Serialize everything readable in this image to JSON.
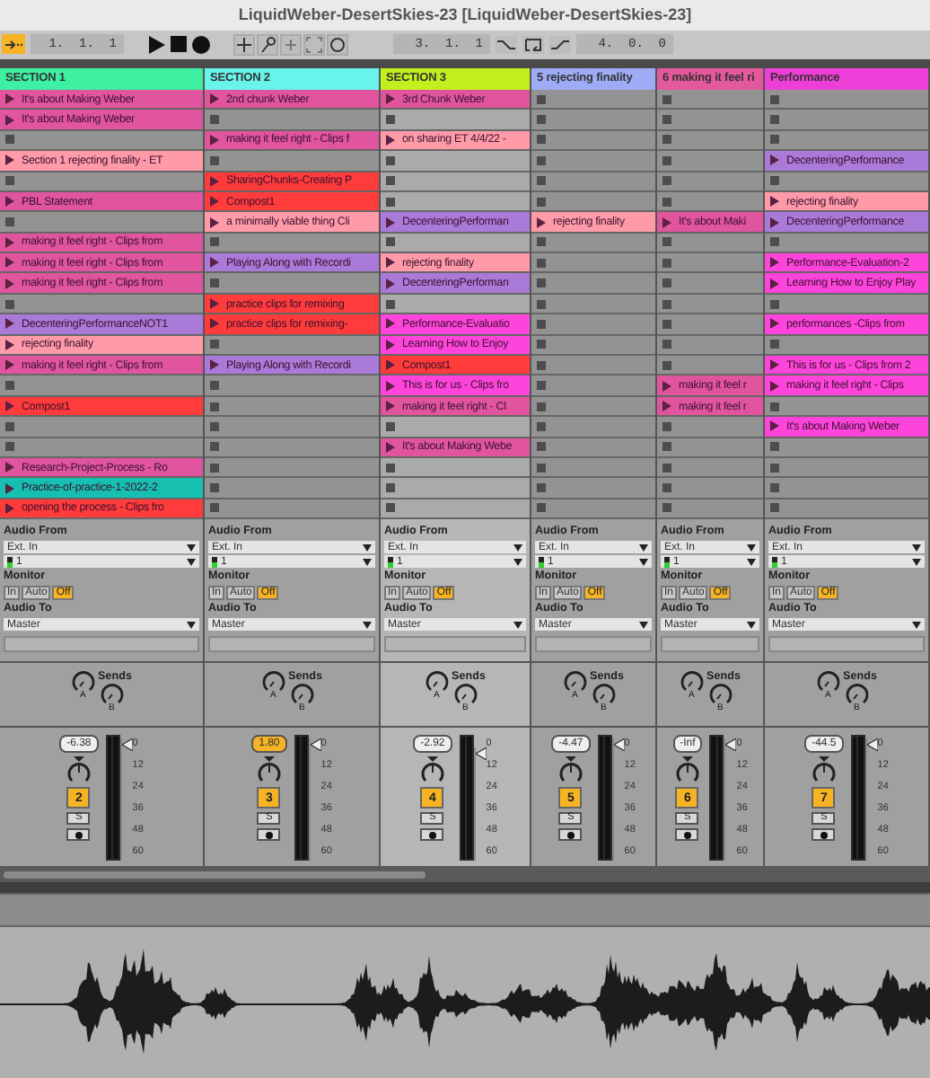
{
  "window": {
    "title": "LiquidWeber-DesertSkies-23  [LiquidWeber-DesertSkies-23]"
  },
  "transport": {
    "follow": true,
    "arrangement_position": "1.  1.  1",
    "loop_start": "3.  1.  1",
    "loop_length": "4.  0.  0"
  },
  "tracks": [
    {
      "name": "SECTION 1",
      "color": "#3ef0a2",
      "selected": false,
      "clips": [
        {
          "kind": "clip",
          "name": "It's about Making Weber",
          "color": "#e0559e"
        },
        {
          "kind": "clip",
          "name": "It's about Making Weber",
          "color": "#e0559e"
        },
        {
          "kind": "empty"
        },
        {
          "kind": "clip",
          "name": "Section 1 rejecting finality - ET",
          "color": "#ff9ba8"
        },
        {
          "kind": "empty"
        },
        {
          "kind": "clip",
          "name": "PBL Statement",
          "color": "#e0559e"
        },
        {
          "kind": "empty"
        },
        {
          "kind": "clip",
          "name": "making it feel right - Clips from",
          "color": "#e0559e"
        },
        {
          "kind": "clip",
          "name": "making it feel right - Clips from",
          "color": "#e0559e"
        },
        {
          "kind": "clip",
          "name": "making it feel right - Clips from",
          "color": "#e0559e"
        },
        {
          "kind": "empty"
        },
        {
          "kind": "clip",
          "name": "DecenteringPerformanceNOT1",
          "color": "#a97ad8"
        },
        {
          "kind": "clip",
          "name": "rejecting finality",
          "color": "#ff9ba8"
        },
        {
          "kind": "clip",
          "name": "making it feel right - Clips from",
          "color": "#e0559e"
        },
        {
          "kind": "empty"
        },
        {
          "kind": "clip",
          "name": "Compost1",
          "color": "#ff3b3b"
        },
        {
          "kind": "empty"
        },
        {
          "kind": "empty"
        },
        {
          "kind": "clip",
          "name": "Research-Project-Process - Ro",
          "color": "#e0559e"
        },
        {
          "kind": "clip",
          "name": "Practice-of-practice-1-2022-2",
          "color": "#17bfb0"
        },
        {
          "kind": "clip",
          "name": "opening the process - Clips fro",
          "color": "#ff3b3b"
        }
      ],
      "audio_from_label": "Audio From",
      "audio_from": "Ext. In",
      "input_channel": "1",
      "monitor_label": "Monitor",
      "monitor": [
        {
          "label": "In",
          "selected": false
        },
        {
          "label": "Auto",
          "selected": false
        },
        {
          "label": "Off",
          "selected": true
        }
      ],
      "audio_to_label": "Audio To",
      "audio_to": "Master",
      "sends_label": "Sends",
      "sends": [
        "A",
        "B"
      ],
      "volume": "-6.38",
      "volume_highlighted": false,
      "fader": {
        "level": 0.97
      },
      "number": "2",
      "active": true,
      "solo": "S",
      "meter_scale": [
        "0",
        "12",
        "24",
        "36",
        "48",
        "60"
      ]
    },
    {
      "name": "SECTION 2",
      "color": "#68f4ea",
      "selected": false,
      "clips": [
        {
          "kind": "clip",
          "name": "2nd chunk Weber",
          "color": "#e0559e"
        },
        {
          "kind": "empty"
        },
        {
          "kind": "clip",
          "name": "making it feel right - Clips f",
          "color": "#e0559e"
        },
        {
          "kind": "empty"
        },
        {
          "kind": "clip",
          "name": "SharingChunks-Creating P",
          "color": "#ff3b3b"
        },
        {
          "kind": "clip",
          "name": "Compost1",
          "color": "#ff3b3b"
        },
        {
          "kind": "clip",
          "name": "a minimally viable thing Cli",
          "color": "#ff9ba8"
        },
        {
          "kind": "empty"
        },
        {
          "kind": "clip",
          "name": "Playing Along with Recordi",
          "color": "#a97ad8"
        },
        {
          "kind": "empty"
        },
        {
          "kind": "clip",
          "name": "practice clips for remixing",
          "color": "#ff3b3b"
        },
        {
          "kind": "clip",
          "name": "practice clips for remixing-",
          "color": "#ff3b3b"
        },
        {
          "kind": "empty"
        },
        {
          "kind": "clip",
          "name": "Playing Along with Recordi",
          "color": "#a97ad8"
        },
        {
          "kind": "empty"
        },
        {
          "kind": "empty"
        },
        {
          "kind": "empty"
        },
        {
          "kind": "empty"
        },
        {
          "kind": "empty"
        },
        {
          "kind": "empty"
        },
        {
          "kind": "empty"
        }
      ],
      "audio_from_label": "Audio From",
      "audio_from": "Ext. In",
      "input_channel": "1",
      "monitor_label": "Monitor",
      "monitor": [
        {
          "label": "In",
          "selected": false
        },
        {
          "label": "Auto",
          "selected": false
        },
        {
          "label": "Off",
          "selected": true
        }
      ],
      "audio_to_label": "Audio To",
      "audio_to": "Master",
      "sends_label": "Sends",
      "sends": [
        "A",
        "B"
      ],
      "volume": "1.80",
      "volume_highlighted": true,
      "fader": {
        "level": 0.97
      },
      "number": "3",
      "active": true,
      "solo": "S",
      "meter_scale": [
        "0",
        "12",
        "24",
        "36",
        "48",
        "60"
      ]
    },
    {
      "name": "SECTION 3",
      "color": "#c2f01e",
      "selected": true,
      "clips": [
        {
          "kind": "clip",
          "name": "3rd Chunk Weber",
          "color": "#e0559e"
        },
        {
          "kind": "empty"
        },
        {
          "kind": "clip",
          "name": "on sharing ET 4/4/22 -",
          "color": "#ff9ba8"
        },
        {
          "kind": "empty"
        },
        {
          "kind": "empty"
        },
        {
          "kind": "empty"
        },
        {
          "kind": "clip",
          "name": "DecenteringPerforman",
          "color": "#a97ad8"
        },
        {
          "kind": "empty"
        },
        {
          "kind": "clip",
          "name": "rejecting finality",
          "color": "#ff9ba8"
        },
        {
          "kind": "clip",
          "name": "DecenteringPerforman",
          "color": "#a97ad8"
        },
        {
          "kind": "empty"
        },
        {
          "kind": "clip",
          "name": "Performance-Evaluatio",
          "color": "#ff44dc"
        },
        {
          "kind": "clip",
          "name": "Learning How to Enjoy",
          "color": "#ff44dc"
        },
        {
          "kind": "clip",
          "name": "Compost1",
          "color": "#ff3b3b"
        },
        {
          "kind": "clip",
          "name": "This is for us - Clips fro",
          "color": "#ff44dc"
        },
        {
          "kind": "clip",
          "name": "making it feel right - Cl",
          "color": "#e0559e"
        },
        {
          "kind": "empty"
        },
        {
          "kind": "clip",
          "name": "It's about Making Webe",
          "color": "#e0559e"
        },
        {
          "kind": "empty"
        },
        {
          "kind": "empty"
        },
        {
          "kind": "empty"
        }
      ],
      "audio_from_label": "Audio From",
      "audio_from": "Ext. In",
      "input_channel": "1",
      "monitor_label": "Monitor",
      "monitor": [
        {
          "label": "In",
          "selected": false
        },
        {
          "label": "Auto",
          "selected": false
        },
        {
          "label": "Off",
          "selected": true
        }
      ],
      "audio_to_label": "Audio To",
      "audio_to": "Master",
      "sends_label": "Sends",
      "sends": [
        "A",
        "B"
      ],
      "volume": "-2.92",
      "volume_highlighted": false,
      "fader": {
        "level": 0.9
      },
      "number": "4",
      "active": true,
      "solo": "S",
      "meter_scale": [
        "0",
        "12",
        "24",
        "36",
        "48",
        "60"
      ]
    },
    {
      "name": "5 rejecting finality",
      "color": "#9eabf7",
      "selected": false,
      "clips": [
        {
          "kind": "empty"
        },
        {
          "kind": "empty"
        },
        {
          "kind": "empty"
        },
        {
          "kind": "empty"
        },
        {
          "kind": "empty"
        },
        {
          "kind": "empty"
        },
        {
          "kind": "clip",
          "name": "rejecting finality",
          "color": "#ff9ba8"
        },
        {
          "kind": "empty"
        },
        {
          "kind": "empty"
        },
        {
          "kind": "empty"
        },
        {
          "kind": "empty"
        },
        {
          "kind": "empty"
        },
        {
          "kind": "empty"
        },
        {
          "kind": "empty"
        },
        {
          "kind": "empty"
        },
        {
          "kind": "empty"
        },
        {
          "kind": "empty"
        },
        {
          "kind": "empty"
        },
        {
          "kind": "empty"
        },
        {
          "kind": "empty"
        },
        {
          "kind": "empty"
        }
      ],
      "audio_from_label": "Audio From",
      "audio_from": "Ext. In",
      "input_channel": "1",
      "monitor_label": "Monitor",
      "monitor": [
        {
          "label": "In",
          "selected": false
        },
        {
          "label": "Auto",
          "selected": false
        },
        {
          "label": "Off",
          "selected": true
        }
      ],
      "audio_to_label": "Audio To",
      "audio_to": "Master",
      "sends_label": "Sends",
      "sends": [
        "A",
        "B"
      ],
      "volume": "-4.47",
      "volume_highlighted": false,
      "fader": {
        "level": 0.97
      },
      "number": "5",
      "active": true,
      "solo": "S",
      "meter_scale": [
        "0",
        "12",
        "24",
        "36",
        "48",
        "60"
      ]
    },
    {
      "name": "6 making it feel ri",
      "color": "#e4599c",
      "selected": false,
      "clips": [
        {
          "kind": "empty"
        },
        {
          "kind": "empty"
        },
        {
          "kind": "empty"
        },
        {
          "kind": "empty"
        },
        {
          "kind": "empty"
        },
        {
          "kind": "empty"
        },
        {
          "kind": "clip",
          "name": "It's about Maki",
          "color": "#e0559e"
        },
        {
          "kind": "empty"
        },
        {
          "kind": "empty"
        },
        {
          "kind": "empty"
        },
        {
          "kind": "empty"
        },
        {
          "kind": "empty"
        },
        {
          "kind": "empty"
        },
        {
          "kind": "empty"
        },
        {
          "kind": "clip",
          "name": "making it feel r",
          "color": "#e0559e"
        },
        {
          "kind": "clip",
          "name": "making it feel r",
          "color": "#e0559e"
        },
        {
          "kind": "empty"
        },
        {
          "kind": "empty"
        },
        {
          "kind": "empty"
        },
        {
          "kind": "empty"
        },
        {
          "kind": "empty"
        }
      ],
      "audio_from_label": "Audio From",
      "audio_from": "Ext. In",
      "input_channel": "1",
      "monitor_label": "Monitor",
      "monitor": [
        {
          "label": "In",
          "selected": false
        },
        {
          "label": "Auto",
          "selected": false
        },
        {
          "label": "Off",
          "selected": true
        }
      ],
      "audio_to_label": "Audio To",
      "audio_to": "Master",
      "sends_label": "Sends",
      "sends": [
        "A",
        "B"
      ],
      "volume": "-Inf",
      "volume_highlighted": false,
      "fader": {
        "level": 0.97
      },
      "number": "6",
      "active": true,
      "solo": "S",
      "meter_scale": [
        "0",
        "12",
        "24",
        "36",
        "48",
        "60"
      ]
    },
    {
      "name": "Performance",
      "color": "#ee3ed8",
      "selected": false,
      "clips": [
        {
          "kind": "empty"
        },
        {
          "kind": "empty"
        },
        {
          "kind": "empty"
        },
        {
          "kind": "clip",
          "name": "DecenteringPerformance",
          "color": "#a97ad8"
        },
        {
          "kind": "empty"
        },
        {
          "kind": "clip",
          "name": "rejecting finality",
          "color": "#ff9ba8"
        },
        {
          "kind": "clip",
          "name": "DecenteringPerformance",
          "color": "#a97ad8"
        },
        {
          "kind": "empty"
        },
        {
          "kind": "clip",
          "name": "Performance-Evaluation-2",
          "color": "#ff44dc"
        },
        {
          "kind": "clip",
          "name": "Learning How to Enjoy Play",
          "color": "#ff44dc"
        },
        {
          "kind": "empty"
        },
        {
          "kind": "clip",
          "name": "performances -Clips from",
          "color": "#ff44dc"
        },
        {
          "kind": "empty"
        },
        {
          "kind": "clip",
          "name": "This is for us - Clips from 2",
          "color": "#ff44dc"
        },
        {
          "kind": "clip",
          "name": "making it feel right - Clips",
          "color": "#ff44dc"
        },
        {
          "kind": "empty"
        },
        {
          "kind": "clip",
          "name": "It's about Making Weber",
          "color": "#ff44dc"
        },
        {
          "kind": "empty"
        },
        {
          "kind": "empty"
        },
        {
          "kind": "empty"
        },
        {
          "kind": "empty"
        }
      ],
      "audio_from_label": "Audio From",
      "audio_from": "Ext. In",
      "input_channel": "1",
      "monitor_label": "Monitor",
      "monitor": [
        {
          "label": "In",
          "selected": false
        },
        {
          "label": "Auto",
          "selected": false
        },
        {
          "label": "Off",
          "selected": true
        }
      ],
      "audio_to_label": "Audio To",
      "audio_to": "Master",
      "sends_label": "Sends",
      "sends": [
        "A",
        "B"
      ],
      "volume": "-44.5",
      "volume_highlighted": false,
      "fader": {
        "level": 0.97
      },
      "number": "7",
      "active": true,
      "solo": "S",
      "meter_scale": [
        "0",
        "12",
        "24",
        "36",
        "48",
        "60"
      ]
    }
  ]
}
